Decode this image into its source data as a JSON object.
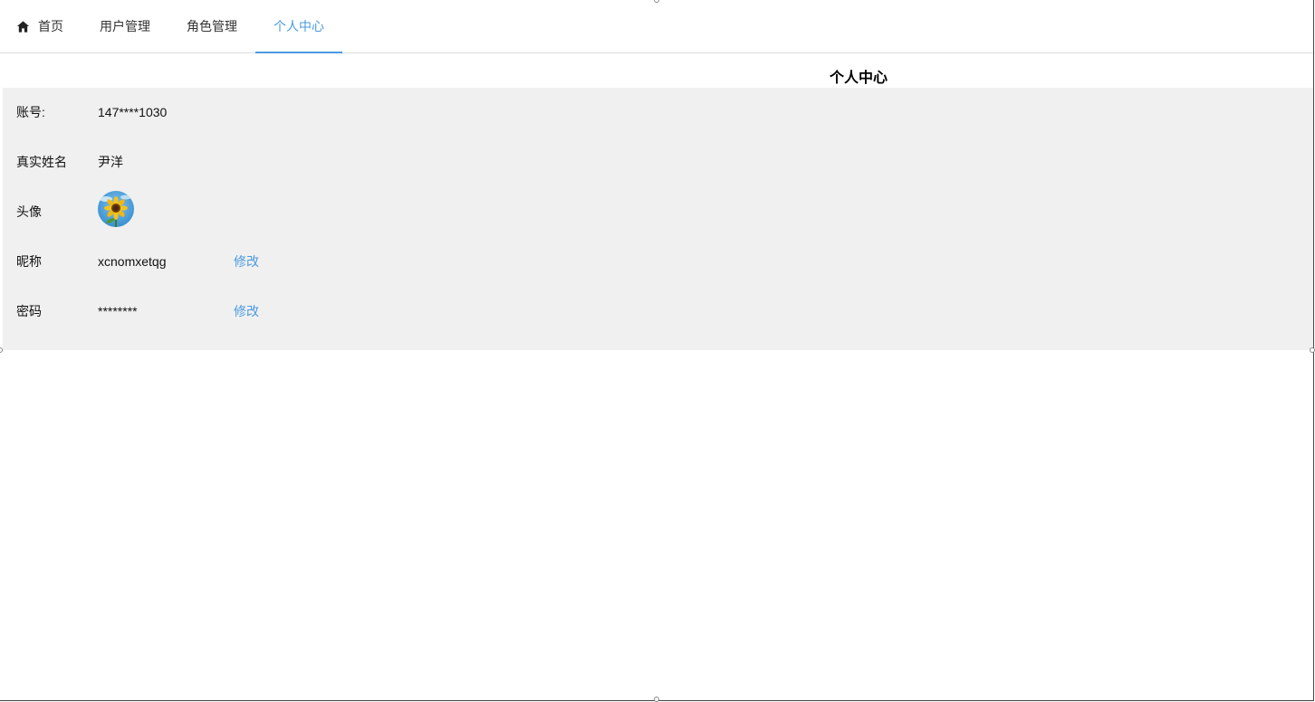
{
  "tabs": [
    {
      "label": "首页",
      "icon": "home-icon",
      "active": false
    },
    {
      "label": "用户管理",
      "active": false
    },
    {
      "label": "角色管理",
      "active": false
    },
    {
      "label": "个人中心",
      "active": true
    }
  ],
  "page": {
    "title": "个人中心"
  },
  "profile": {
    "account": {
      "label": "账号:",
      "value": "147****1030"
    },
    "real_name": {
      "label": "真实姓名",
      "value": "尹洋"
    },
    "avatar": {
      "label": "头像",
      "icon": "sunflower-avatar"
    },
    "nickname": {
      "label": "昵称",
      "value": "xcnomxetqg",
      "action": "修改"
    },
    "password": {
      "label": "密码",
      "value": "********",
      "action": "修改"
    }
  },
  "colors": {
    "accent": "#4a9be0",
    "panel_bg": "#f0f0f0"
  }
}
